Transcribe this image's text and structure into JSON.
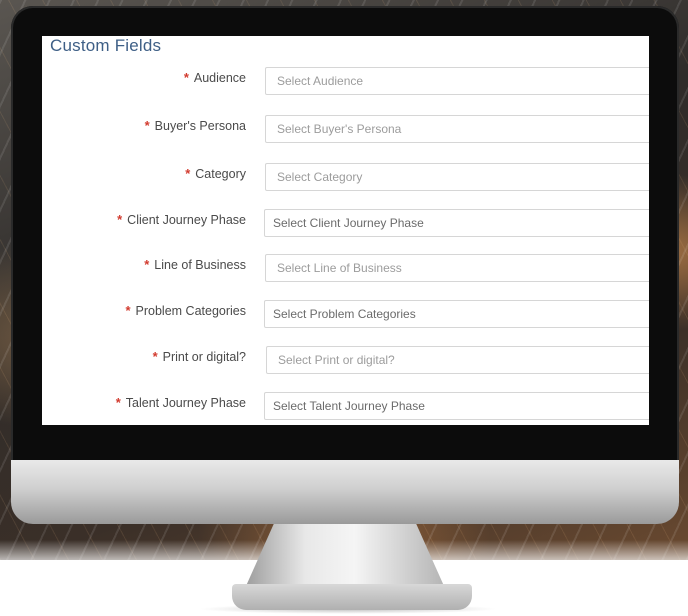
{
  "form": {
    "title": "Custom Fields",
    "required_marker": "*",
    "fields": [
      {
        "label": "Audience",
        "placeholder": "Select Audience"
      },
      {
        "label": "Buyer's Persona",
        "placeholder": "Select Buyer's Persona"
      },
      {
        "label": "Category",
        "placeholder": "Select Category"
      },
      {
        "label": "Client Journey Phase",
        "placeholder": "Select Client Journey Phase"
      },
      {
        "label": "Line of Business",
        "placeholder": "Select Line of Business"
      },
      {
        "label": "Problem Categories",
        "placeholder": "Select Problem Categories"
      },
      {
        "label": "Print or digital?",
        "placeholder": "Select Print or digital?"
      },
      {
        "label": "Talent Journey Phase",
        "placeholder": "Select Talent Journey Phase"
      }
    ]
  },
  "colors": {
    "title": "#3e5f86",
    "required": "#d23a2e",
    "input_border": "#d6d6d6"
  }
}
